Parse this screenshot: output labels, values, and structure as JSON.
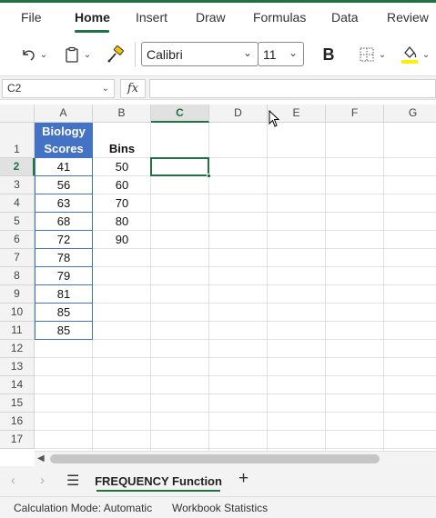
{
  "ribbon": {
    "tabs": [
      {
        "label": "File",
        "active": false
      },
      {
        "label": "Home",
        "active": true
      },
      {
        "label": "Insert",
        "active": false
      },
      {
        "label": "Draw",
        "active": false
      },
      {
        "label": "Formulas",
        "active": false
      },
      {
        "label": "Data",
        "active": false
      },
      {
        "label": "Review",
        "active": false
      }
    ],
    "font_name": "Calibri",
    "font_size": "11",
    "bold_label": "B",
    "icons": [
      "undo-icon",
      "paste-icon",
      "format-painter-icon",
      "borders-icon",
      "fill-color-icon"
    ]
  },
  "formula_bar": {
    "name_box": "C2",
    "fx_label": "fx",
    "formula": ""
  },
  "sheet": {
    "columns": [
      "A",
      "B",
      "C",
      "D",
      "E",
      "F",
      "G"
    ],
    "selected_column": "C",
    "rows": [
      "1",
      "2",
      "3",
      "4",
      "5",
      "6",
      "7",
      "8",
      "9",
      "10",
      "11",
      "12",
      "13",
      "14",
      "15",
      "16",
      "17"
    ],
    "selected_row": "2",
    "header_a_line1": "Biology",
    "header_a_line2": "Scores",
    "header_b": "Bins",
    "scores": [
      "41",
      "56",
      "63",
      "68",
      "72",
      "78",
      "79",
      "81",
      "85",
      "85"
    ],
    "bins": [
      "50",
      "60",
      "70",
      "80",
      "90"
    ],
    "accent_color": "#1f7244",
    "table_color": "#4472c4"
  },
  "sheet_tabs": {
    "active_tab": "FREQUENCY Function",
    "add_label": "+"
  },
  "status_bar": {
    "calc_mode": "Calculation Mode: Automatic",
    "workbook_stats": "Workbook Statistics"
  }
}
